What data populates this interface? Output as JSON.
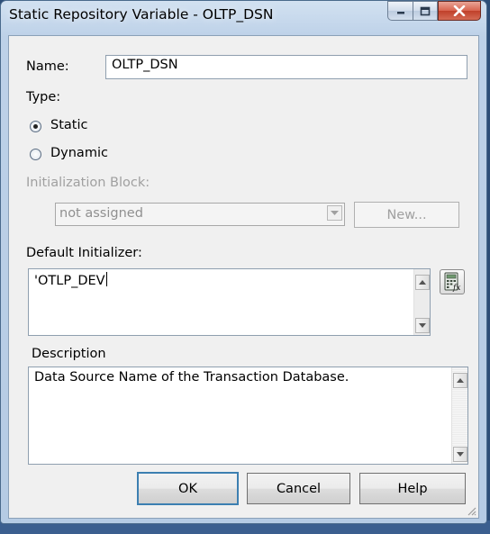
{
  "window": {
    "title": "Static Repository Variable - OLTP_DSN",
    "buttons": {
      "minimize": "minimize-icon",
      "maximize": "maximize-icon",
      "close": "close-icon"
    }
  },
  "form": {
    "name_label": "Name:",
    "name_value": "OLTP_DSN",
    "type_label": "Type:",
    "type_options": [
      {
        "label": "Static",
        "selected": true
      },
      {
        "label": "Dynamic",
        "selected": false
      }
    ],
    "init_block_label": "Initialization Block:",
    "init_block_value": "not assigned",
    "new_button": "New...",
    "default_init_label": "Default Initializer:",
    "default_init_value": "'OTLP_DEV",
    "expression_builder_icon": "expression-builder-icon",
    "description_label": "Description",
    "description_value": "Data Source Name of the Transaction Database."
  },
  "footer": {
    "ok": "OK",
    "cancel": "Cancel",
    "help": "Help"
  },
  "colors": {
    "frame": "#bdd1e8",
    "client": "#f0f0f0",
    "close_red": "#c0402a",
    "default_button_border": "#3c7fb1"
  }
}
